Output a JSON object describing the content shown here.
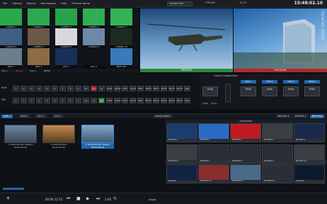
{
  "menu": [
    "File",
    "Options",
    "Macros",
    "Workspaces",
    "Help",
    "Preview Name"
  ],
  "topbar": {
    "session": "Update files",
    "rec": "STREAM",
    "stats": "18:00",
    "clock": "15:48:02.10"
  },
  "vgrid": {
    "row1": [
      "CAMERA 1",
      "CAMERA 2",
      "CAMERA 3",
      "CAMERA 4",
      "CAMERA 5"
    ],
    "row2": [
      "CAMERA 6",
      "CAMERA 7",
      "CAMERA 8",
      "CAMERA 9",
      "CAMERA 10"
    ],
    "row3": [
      "DDR 1",
      "DDR 2",
      "GFX 1",
      "GFX 2",
      "NEW SET"
    ]
  },
  "chips": [
    "COL 1",
    "BLACK",
    "COL 2",
    "NEWS"
  ],
  "preview": {
    "label": "PREVIEW"
  },
  "program": {
    "label": "PROGRAM",
    "overlay": "NewTek 8000"
  },
  "switcher": {
    "row_labels": [
      "PGM",
      "PRV"
    ],
    "buttons": [
      "1",
      "2",
      "3",
      "4",
      "5",
      "6",
      "7",
      "8",
      "9",
      "10",
      "11",
      "12",
      "DDR",
      "DDR2",
      "GFX",
      "GFX2",
      "NET",
      "NET2",
      "BUF1",
      "BUF2",
      "BUF3",
      "BUF4",
      "BLK"
    ],
    "pgm_active": "11",
    "prv_active": "12"
  },
  "transition": {
    "heads": [
      "DSK 1",
      "DSK 2",
      "DSK 3",
      "DSK 4"
    ],
    "fade": "FADE",
    "take": "TAKE",
    "auto": "AUTO",
    "sub": "Output Configuration"
  },
  "tabs": [
    "DDR 1",
    "DDR 2",
    "GFX 1",
    "GFX 2",
    "AUDIO MIXER",
    "BUFFER 1",
    "BUFFER 2",
    "BUFFERS"
  ],
  "mediabin": {
    "clips": [
      {
        "name": "1 TCXXXXX Bus Station",
        "time": "00:00:28:00"
      },
      {
        "name": "2 TCXXXXX Bus",
        "time": "00:00:12:00"
      },
      {
        "name": "3 TCXXXXX Bus Station",
        "time": "00:00:18:00"
      }
    ]
  },
  "effects": {
    "header": "Animations",
    "row1": [
      "BUFFER 1",
      "BUFFER 2",
      "BUFFER 3",
      "BUFFER 4",
      "BUFFER 5"
    ],
    "row2": [
      "BUFFER 6",
      "BUFFER 7",
      "BUFFER 8",
      "BUFFER 9",
      "BUFFER 10"
    ],
    "header2": "Stills and Titles",
    "row3": [
      "NewTek",
      "BUFFER 12",
      "BUFFER 13",
      "BUFFER 14",
      "TriCaster"
    ]
  },
  "transport": {
    "time": "00:00:12:15",
    "position": "3:40",
    "mode": "Single"
  }
}
